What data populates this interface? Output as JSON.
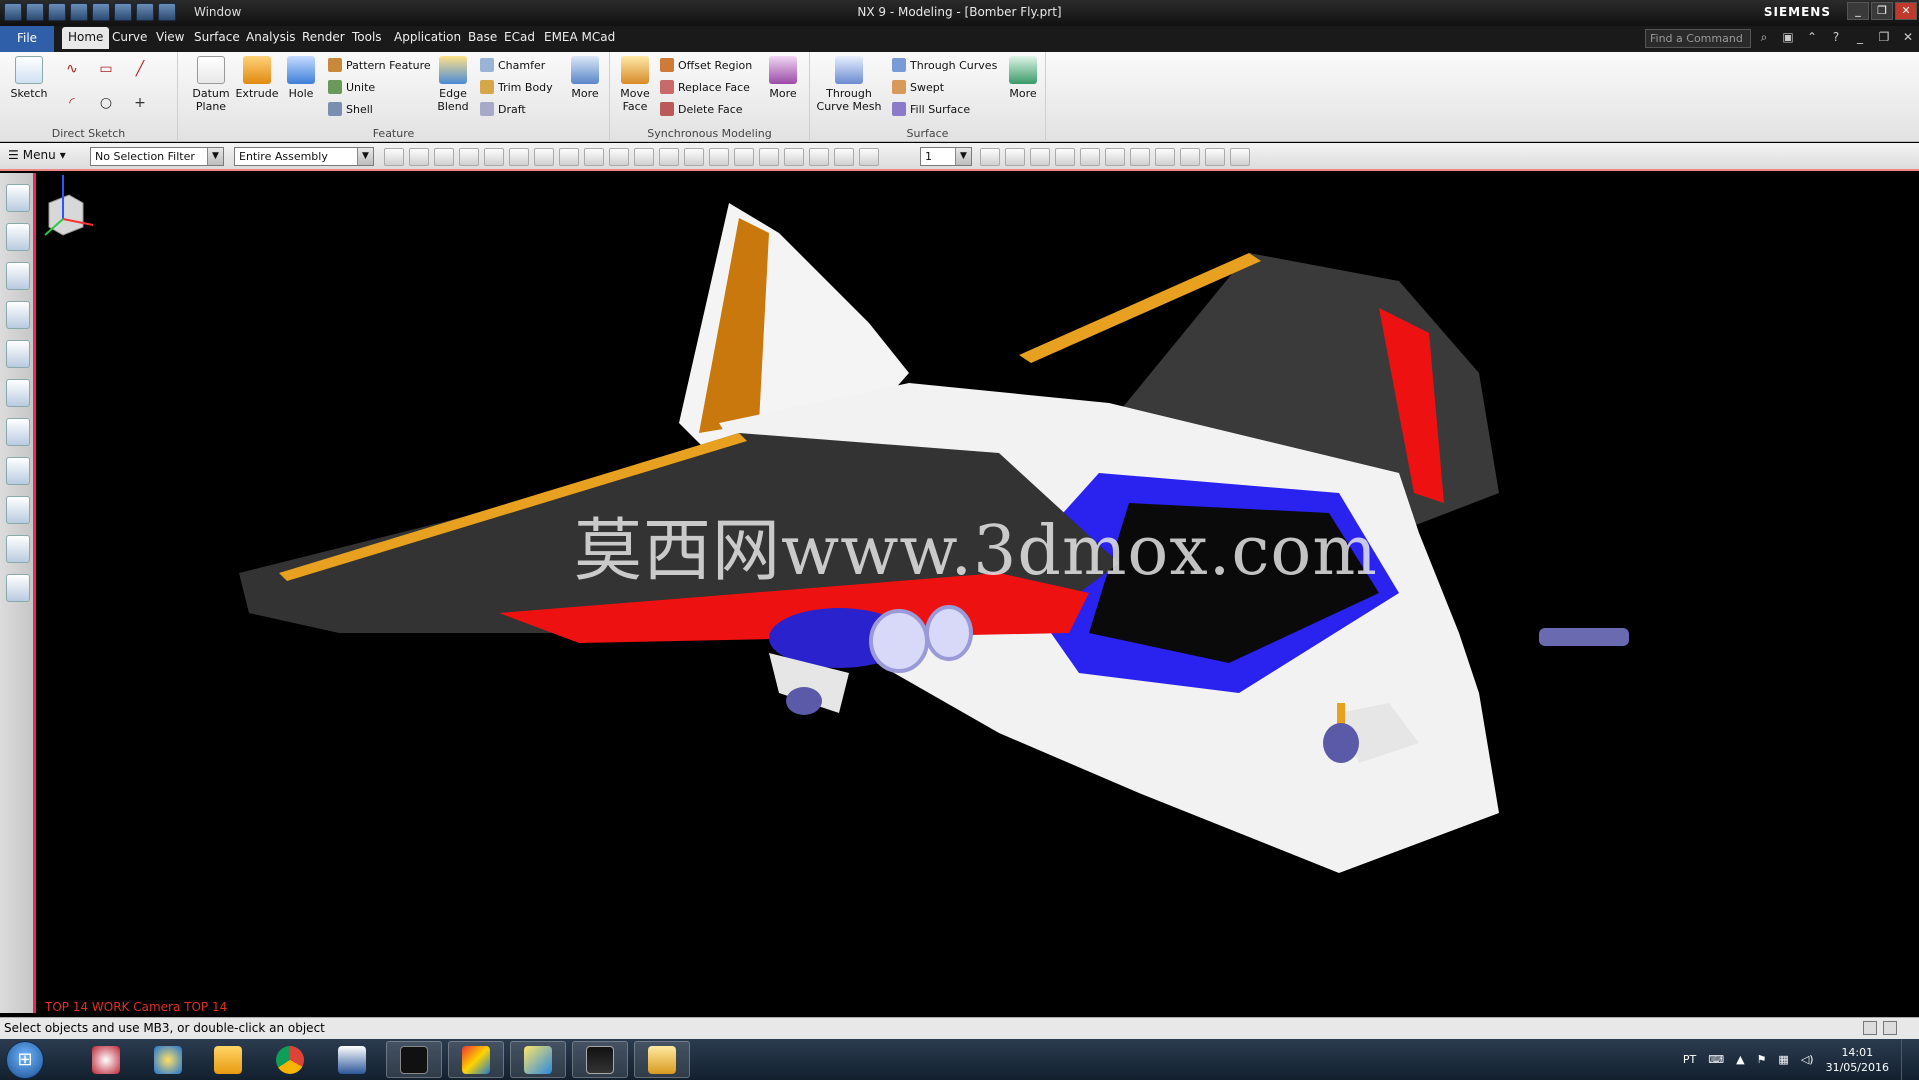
{
  "window": {
    "title": "NX 9 - Modeling - [Bomber Fly.prt]",
    "brand": "SIEMENS",
    "qat_window_label": "Window"
  },
  "tabs": {
    "file": "File",
    "items": [
      "Home",
      "Curve",
      "View",
      "Surface",
      "Analysis",
      "Render",
      "Tools",
      "Application",
      "Base",
      "ECad",
      "EMEA MCad"
    ],
    "find_placeholder": "Find a Command"
  },
  "ribbon": {
    "direct_sketch": {
      "label": "Direct Sketch",
      "sketch": "Sketch"
    },
    "feature": {
      "label": "Feature",
      "datum_plane": "Datum Plane",
      "extrude": "Extrude",
      "hole": "Hole",
      "pattern_feature": "Pattern Feature",
      "unite": "Unite",
      "shell": "Shell",
      "edge_blend": "Edge Blend",
      "chamfer": "Chamfer",
      "trim_body": "Trim Body",
      "draft": "Draft",
      "more": "More"
    },
    "sync": {
      "label": "Synchronous Modeling",
      "move_face": "Move Face",
      "offset_region": "Offset Region",
      "replace_face": "Replace Face",
      "delete_face": "Delete Face",
      "more": "More"
    },
    "surface": {
      "label": "Surface",
      "through_curve_mesh": "Through Curve Mesh",
      "through_curves": "Through Curves",
      "swept": "Swept",
      "fill_surface": "Fill Surface",
      "more": "More"
    }
  },
  "toolbar": {
    "menu": "Menu",
    "selection_filter": "No Selection Filter",
    "scope": "Entire Assembly",
    "layer": "1"
  },
  "viewport": {
    "watermark": "莫西网www.3dmox.com",
    "view_info": "TOP 14 WORK Camera TOP 14"
  },
  "status": {
    "message": "Select objects and use MB3, or double-click an object"
  },
  "taskbar": {
    "language": "PT",
    "time": "14:01",
    "date": "31/05/2016"
  },
  "colors": {
    "accent": "#2f5fa8",
    "viewport_bg": "#000000",
    "view_info_text": "#e03020"
  }
}
